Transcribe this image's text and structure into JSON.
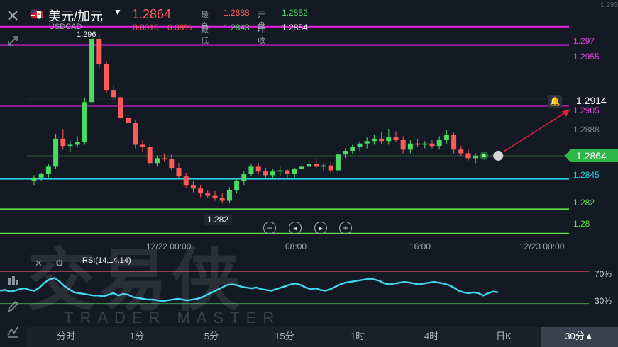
{
  "header": {
    "symbol_name": "美元/加元",
    "symbol_code": "USDCAD",
    "price": "1.2864",
    "change": "0.0010",
    "change_pct": "0.08%",
    "high_label": "最高",
    "high_value": "1.2888",
    "open_label": "开盘",
    "open_value": "1.2852",
    "low_label": "最低",
    "low_value": "1.2843",
    "prev_close_label": "昨收",
    "prev_close_value": "1.2854"
  },
  "toolbar": {
    "close_icon": "close-icon",
    "expand_icon": "expand-icon",
    "candle_icon": "candlestick-icon",
    "draw_icon": "pencil-icon",
    "indicator_icon": "indicator-icon"
  },
  "price_lines": [
    {
      "label": "1.297",
      "value": 1.297,
      "color": "#e020e0"
    },
    {
      "label": "1.2955",
      "value": 1.2955,
      "color": "#e020e0"
    },
    {
      "label": "1.2905",
      "value": 1.2905,
      "color": "#e020e0"
    },
    {
      "label": "1.2845",
      "value": 1.2845,
      "color": "#28d0e8"
    },
    {
      "label": "1.282",
      "value": 1.282,
      "color": "#5de04a"
    },
    {
      "label": "1.28",
      "value": 1.28,
      "color": "#5de04a"
    }
  ],
  "axis": {
    "grid_label_1": "1.2888",
    "current_price": "1.2864",
    "alert_price": "1.2914",
    "top_tick": "1.293"
  },
  "chart_annotations": {
    "high_marker": "1.296",
    "low_marker": "1.282"
  },
  "time_labels": [
    "12/22 00:00",
    "08:00",
    "16:00",
    "12/23 00:00"
  ],
  "rsi": {
    "label": "RSI(14,14,14)",
    "upper": "70%",
    "lower": "30%"
  },
  "timeframes": [
    "分时",
    "1分",
    "5分",
    "15分",
    "1时",
    "4时",
    "日K",
    "30分▲"
  ],
  "active_timeframe": "30分▲",
  "watermark": {
    "cn": "交易侠",
    "en": "TRADER MASTER"
  },
  "colors": {
    "up": "#4cd964",
    "down": "#ff5a5a",
    "magenta": "#e020e0",
    "cyan": "#28d0e8",
    "green_line": "#5de04a"
  },
  "chart_data": {
    "type": "candlestick",
    "ylim": [
      1.2797,
      1.2992
    ],
    "candles": [
      [
        1.2843,
        1.2848,
        1.284,
        1.2846
      ],
      [
        1.2846,
        1.285,
        1.2843,
        1.2849
      ],
      [
        1.2849,
        1.2857,
        1.2846,
        1.2855
      ],
      [
        1.2855,
        1.2882,
        1.2853,
        1.2878
      ],
      [
        1.2878,
        1.2886,
        1.2869,
        1.2872
      ],
      [
        1.2872,
        1.2876,
        1.2867,
        1.2873
      ],
      [
        1.2873,
        1.288,
        1.2871,
        1.2875
      ],
      [
        1.2875,
        1.2912,
        1.2873,
        1.2908
      ],
      [
        1.2908,
        1.2965,
        1.2905,
        1.296
      ],
      [
        1.296,
        1.2964,
        1.2935,
        1.2939
      ],
      [
        1.2939,
        1.2942,
        1.2915,
        1.2918
      ],
      [
        1.2918,
        1.2922,
        1.291,
        1.2912
      ],
      [
        1.2912,
        1.2914,
        1.2893,
        1.2895
      ],
      [
        1.2895,
        1.2897,
        1.2889,
        1.2891
      ],
      [
        1.2891,
        1.2893,
        1.287,
        1.2873
      ],
      [
        1.2873,
        1.2877,
        1.2867,
        1.2871
      ],
      [
        1.2871,
        1.2874,
        1.2855,
        1.2858
      ],
      [
        1.2858,
        1.2864,
        1.2855,
        1.2862
      ],
      [
        1.2862,
        1.2866,
        1.2859,
        1.2861
      ],
      [
        1.2861,
        1.2865,
        1.2852,
        1.2854
      ],
      [
        1.2854,
        1.2858,
        1.2845,
        1.2847
      ],
      [
        1.2847,
        1.285,
        1.2838,
        1.284
      ],
      [
        1.284,
        1.2843,
        1.2834,
        1.2837
      ],
      [
        1.2837,
        1.284,
        1.283,
        1.2833
      ],
      [
        1.2833,
        1.2836,
        1.2829,
        1.2831
      ],
      [
        1.2831,
        1.2835,
        1.2827,
        1.2829
      ],
      [
        1.2829,
        1.2833,
        1.2825,
        1.2827
      ],
      [
        1.2827,
        1.2838,
        1.2825,
        1.2836
      ],
      [
        1.2836,
        1.2845,
        1.2833,
        1.2843
      ],
      [
        1.2843,
        1.2851,
        1.284,
        1.2849
      ],
      [
        1.2849,
        1.2857,
        1.2847,
        1.2855
      ],
      [
        1.2855,
        1.2858,
        1.2849,
        1.2851
      ],
      [
        1.2851,
        1.2854,
        1.2846,
        1.2848
      ],
      [
        1.2848,
        1.2853,
        1.2845,
        1.2851
      ],
      [
        1.2851,
        1.2855,
        1.2847,
        1.2852
      ],
      [
        1.2852,
        1.2853,
        1.2846,
        1.2849
      ],
      [
        1.2849,
        1.2854,
        1.2846,
        1.2853
      ],
      [
        1.2853,
        1.2857,
        1.2851,
        1.2855
      ],
      [
        1.2855,
        1.286,
        1.2852,
        1.2857
      ],
      [
        1.2857,
        1.2861,
        1.2854,
        1.2855
      ],
      [
        1.2855,
        1.2858,
        1.2852,
        1.2856
      ],
      [
        1.2856,
        1.2859,
        1.285,
        1.2852
      ],
      [
        1.2852,
        1.2867,
        1.285,
        1.2865
      ],
      [
        1.2865,
        1.287,
        1.2862,
        1.2868
      ],
      [
        1.2868,
        1.2873,
        1.2865,
        1.2871
      ],
      [
        1.2871,
        1.2876,
        1.2868,
        1.2874
      ],
      [
        1.2874,
        1.2879,
        1.287,
        1.2876
      ],
      [
        1.2876,
        1.2881,
        1.2873,
        1.2878
      ],
      [
        1.2878,
        1.2883,
        1.2874,
        1.2876
      ],
      [
        1.2876,
        1.2886,
        1.2873,
        1.2879
      ],
      [
        1.2879,
        1.2884,
        1.2875,
        1.2877
      ],
      [
        1.2877,
        1.288,
        1.2866,
        1.2869
      ],
      [
        1.2869,
        1.2877,
        1.2866,
        1.2874
      ],
      [
        1.2874,
        1.2878,
        1.2871,
        1.2873
      ],
      [
        1.2873,
        1.2876,
        1.287,
        1.2874
      ],
      [
        1.2874,
        1.2877,
        1.287,
        1.2872
      ],
      [
        1.2872,
        1.288,
        1.2869,
        1.2877
      ],
      [
        1.2877,
        1.2885,
        1.2874,
        1.2881
      ],
      [
        1.2881,
        1.2883,
        1.2866,
        1.2869
      ],
      [
        1.2869,
        1.2872,
        1.2864,
        1.2866
      ],
      [
        1.2866,
        1.2869,
        1.286,
        1.2862
      ],
      [
        1.2862,
        1.2866,
        1.2858,
        1.2864
      ]
    ],
    "rsi": [
      46,
      47,
      45,
      46,
      48,
      49,
      47,
      46,
      50,
      56,
      60,
      62,
      58,
      52,
      48,
      44,
      43,
      42,
      41,
      40,
      40,
      39,
      41,
      43,
      40,
      42,
      41,
      38,
      37,
      36,
      35,
      35,
      34,
      33,
      34,
      35,
      36,
      35,
      34,
      35,
      36,
      38,
      41,
      44,
      47,
      50,
      53,
      54,
      53,
      51,
      50,
      49,
      50,
      48,
      47,
      46,
      48,
      50,
      52,
      54,
      55,
      53,
      50,
      48,
      49,
      47,
      46,
      48,
      51,
      54,
      56,
      57,
      58,
      59,
      60,
      61,
      60,
      58,
      55,
      54,
      55,
      56,
      57,
      56,
      55,
      54,
      55,
      56,
      57,
      56,
      55,
      53,
      50,
      46,
      44,
      43,
      44,
      43,
      40,
      43,
      45,
      44
    ]
  }
}
